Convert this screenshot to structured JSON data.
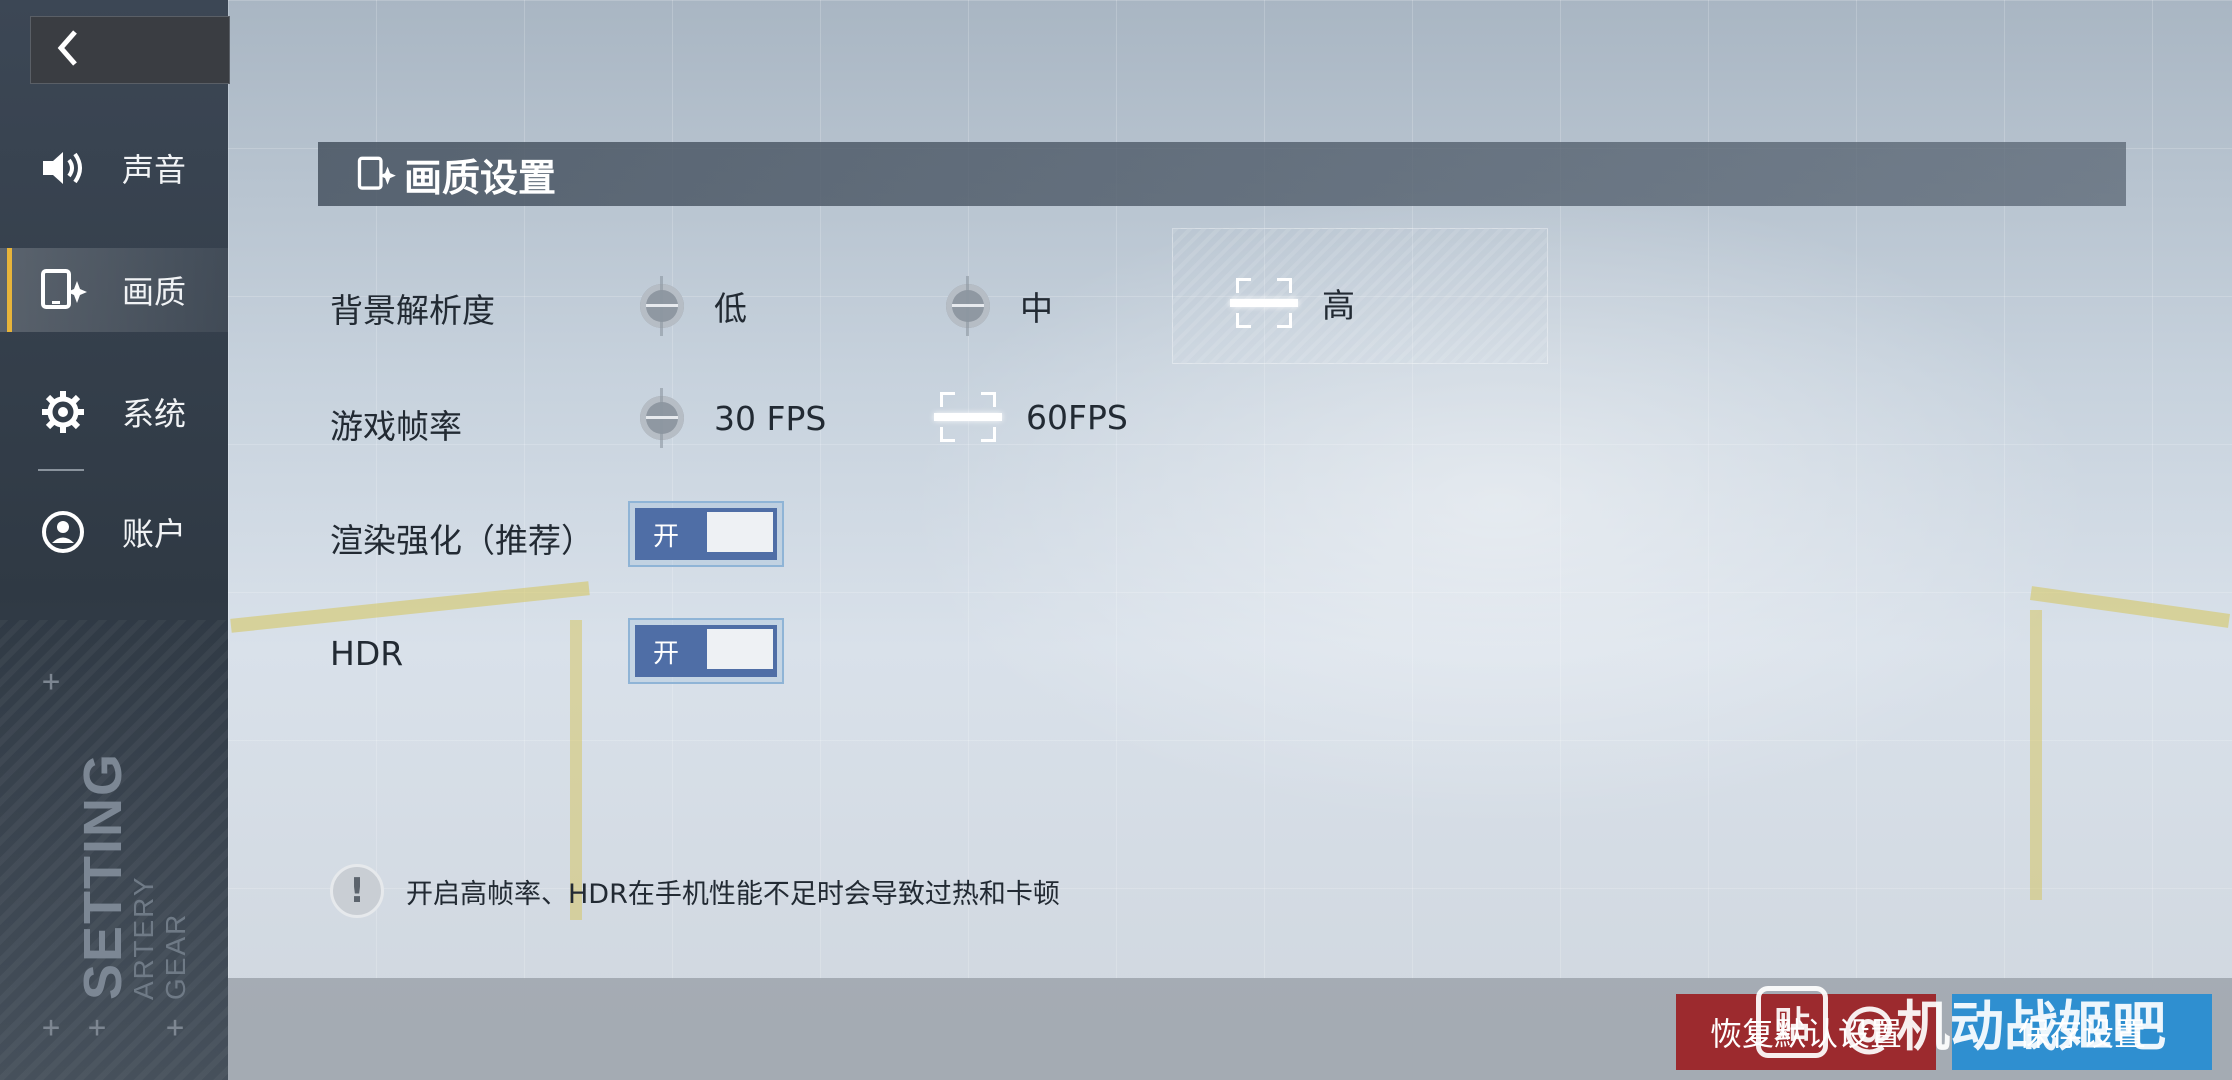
{
  "sidebar": {
    "items": [
      {
        "label": "声音",
        "icon": "speaker-icon"
      },
      {
        "label": "画质",
        "icon": "phone-sparkle-icon"
      },
      {
        "label": "系统",
        "icon": "gear-icon"
      },
      {
        "label": "账户",
        "icon": "user-icon"
      }
    ],
    "active_index": 1,
    "brand_vertical": "SETTING",
    "brand_sub": "ARTERY GEAR"
  },
  "section": {
    "title": "画质设置"
  },
  "settings": {
    "bg_resolution": {
      "label": "背景解析度",
      "options": [
        "低",
        "中",
        "高"
      ],
      "selected": "高"
    },
    "fps": {
      "label": "游戏帧率",
      "options": [
        "30 FPS",
        "60FPS"
      ],
      "selected": "60FPS"
    },
    "render_enhance": {
      "label": "渲染强化（推荐）",
      "state": "开",
      "on": true
    },
    "hdr": {
      "label": "HDR",
      "state": "开",
      "on": true
    }
  },
  "notice": {
    "text": "开启高帧率、HDR在手机性能不足时会导致过热和卡顿"
  },
  "footer": {
    "reset_label": "恢复默认设置",
    "save_label": "保存设置"
  },
  "watermark": {
    "badge": "贴",
    "text": "@机动战姬吧"
  },
  "colors": {
    "accent": "#e7b43a",
    "toggle_on": "#4f6ea6",
    "reset": "#9c2a2e",
    "save": "#2f8fd0"
  }
}
